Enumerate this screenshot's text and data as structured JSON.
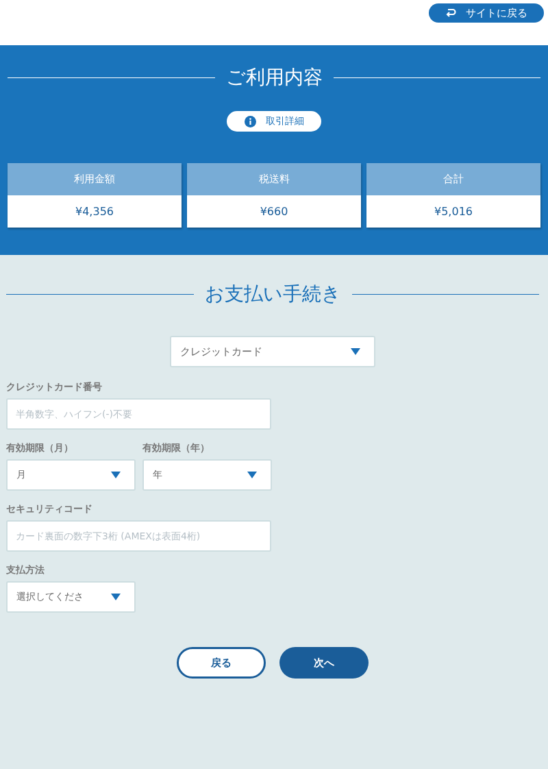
{
  "back_to_site": "サイトに戻る",
  "summary": {
    "title": "ご利用内容",
    "details_button": "取引詳細",
    "cards": [
      {
        "label": "利用金額",
        "value": "¥4,356"
      },
      {
        "label": "税送料",
        "value": "¥660"
      },
      {
        "label": "合計",
        "value": "¥5,016"
      }
    ]
  },
  "payment": {
    "title": "お支払い手続き",
    "method": "クレジットカード",
    "field_rows": [
      [
        {
          "kind": "input",
          "label": "クレジットカード番号",
          "placeholder": "半角数字、ハイフン(-)不要"
        }
      ],
      [
        {
          "kind": "select",
          "label": "有効期限（月）",
          "value": "月"
        },
        {
          "kind": "select",
          "label": "有効期限（年）",
          "value": "年"
        }
      ],
      [
        {
          "kind": "input",
          "label": "セキュリティコード",
          "placeholder": "カード裏面の数字下3桁 (AMEXは表面4桁)"
        }
      ],
      [
        {
          "kind": "select",
          "label": "支払方法",
          "value": "選択してくださ"
        }
      ]
    ]
  },
  "buttons": {
    "back": "戻る",
    "next": "次へ"
  }
}
